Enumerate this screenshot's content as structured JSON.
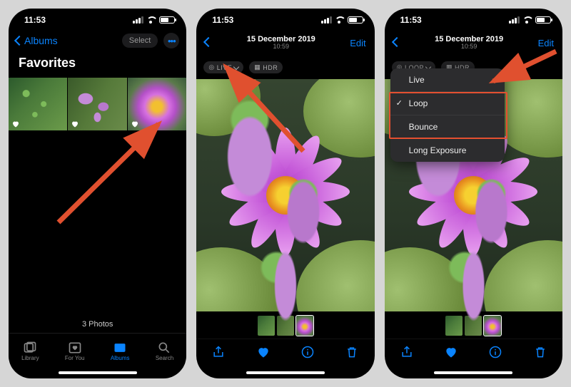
{
  "status": {
    "time": "11:53"
  },
  "screen1": {
    "back_label": "Albums",
    "select_label": "Select",
    "title": "Favorites",
    "photo_count": "3 Photos",
    "tabs": {
      "library": "Library",
      "for_you": "For You",
      "albums": "Albums",
      "search": "Search"
    }
  },
  "screen2": {
    "date": "15 December 2019",
    "time": "10:59",
    "edit_label": "Edit",
    "badges": {
      "live": "LIVE",
      "hdr": "HDR"
    }
  },
  "screen3": {
    "date": "15 December 2019",
    "time": "10:59",
    "edit_label": "Edit",
    "badges": {
      "loop": "LOOP",
      "hdr": "HDR"
    },
    "menu": {
      "live": "Live",
      "loop": "Loop",
      "bounce": "Bounce",
      "long_exposure": "Long Exposure"
    }
  }
}
